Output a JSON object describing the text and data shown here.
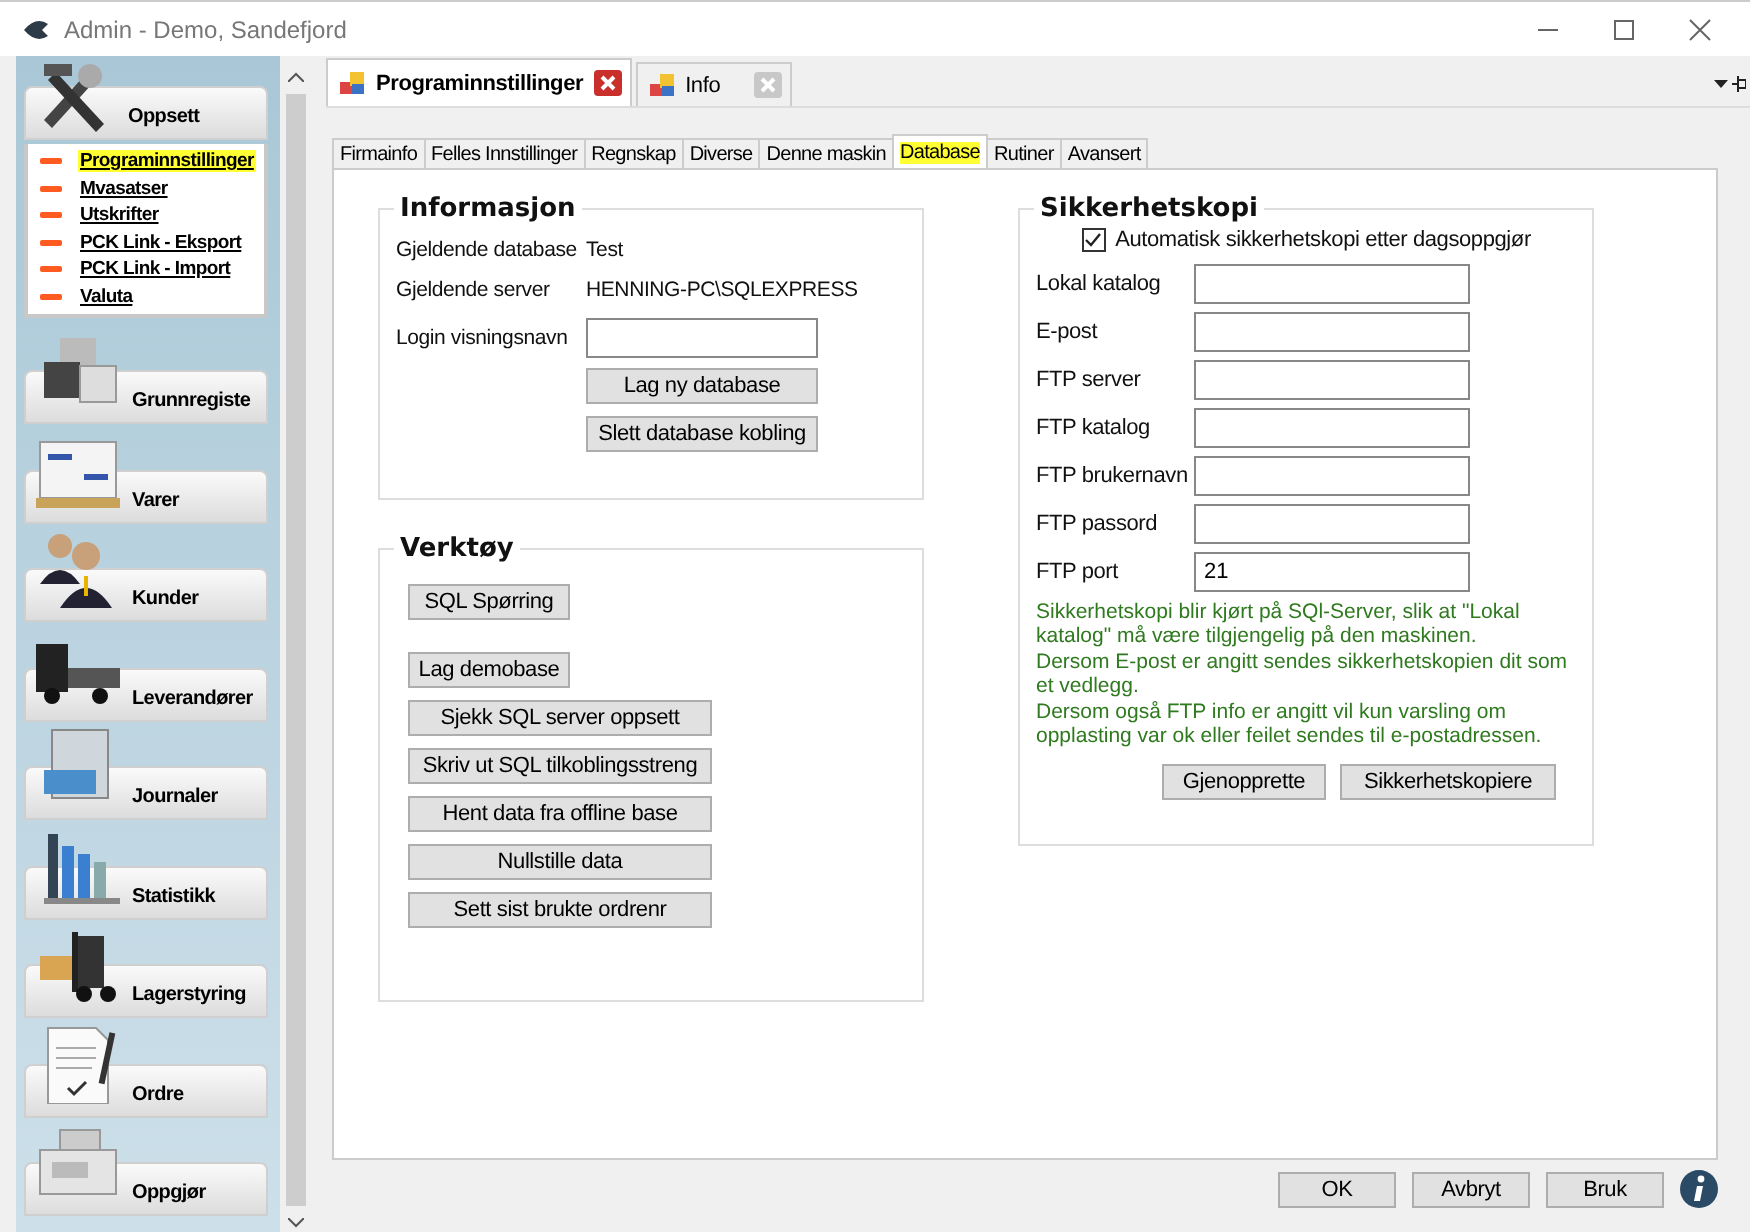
{
  "window": {
    "title": "Admin - Demo, Sandefjord"
  },
  "sidebar": {
    "sections": [
      {
        "label": "Oppsett",
        "expanded": true,
        "items": [
          {
            "label": "Programinnstillinger",
            "selected": true
          },
          {
            "label": "Mvasatser",
            "selected": false
          },
          {
            "label": "Utskrifter",
            "selected": false
          },
          {
            "label": "PCK Link - Eksport",
            "selected": false
          },
          {
            "label": "PCK Link - Import",
            "selected": false
          },
          {
            "label": "Valuta",
            "selected": false
          }
        ]
      },
      {
        "label": "Grunnregiste"
      },
      {
        "label": "Varer"
      },
      {
        "label": "Kunder"
      },
      {
        "label": "Leverandører"
      },
      {
        "label": "Journaler"
      },
      {
        "label": "Statistikk"
      },
      {
        "label": "Lagerstyring"
      },
      {
        "label": "Ordre"
      },
      {
        "label": "Oppgjør"
      }
    ]
  },
  "doc_tabs": [
    {
      "label": "Programinnstillinger",
      "selected": true
    },
    {
      "label": "Info",
      "selected": false
    }
  ],
  "tabs": [
    {
      "label": "Firmainfo",
      "selected": false
    },
    {
      "label": "Felles Innstillinger",
      "selected": false
    },
    {
      "label": "Regnskap",
      "selected": false
    },
    {
      "label": "Diverse",
      "selected": false
    },
    {
      "label": "Denne maskin",
      "selected": false
    },
    {
      "label": "Database",
      "selected": true
    },
    {
      "label": "Rutiner",
      "selected": false
    },
    {
      "label": "Avansert",
      "selected": false
    }
  ],
  "informasjon": {
    "title": "Informasjon",
    "rows": [
      {
        "label": "Gjeldende database",
        "value": "Test"
      },
      {
        "label": "Gjeldende server",
        "value": "HENNING-PC\\SQLEXPRESS"
      }
    ],
    "login": {
      "label": "Login visningsnavn"
    },
    "buttons": [
      "Lag ny database",
      "Slett database kobling"
    ]
  },
  "verktoy": {
    "title": "Verktøy",
    "buttons": [
      {
        "label": "SQL Spørring",
        "kind": "small"
      },
      {
        "label": "Lag demobase",
        "kind": "small"
      },
      {
        "label": "Sjekk SQL server oppsett",
        "kind": "wide"
      },
      {
        "label": "Skriv ut SQL tilkoblingsstreng",
        "kind": "wide"
      },
      {
        "label": "Hent data fra offline base",
        "kind": "wide"
      },
      {
        "label": "Nullstille data",
        "kind": "wide"
      },
      {
        "label": "Sett sist brukte ordrenr",
        "kind": "wide"
      }
    ]
  },
  "sikkerhetskopi": {
    "title": "Sikkerhetskopi",
    "auto": {
      "label": "Automatisk sikkerhetskopi etter dagsoppgjør",
      "checked": true
    },
    "fields": [
      {
        "label": "Lokal katalog"
      },
      {
        "label": "E-post"
      },
      {
        "label": "FTP server"
      },
      {
        "label": "FTP katalog"
      },
      {
        "label": "FTP brukernavn"
      },
      {
        "label": "FTP passord"
      },
      {
        "label": "FTP port",
        "value": "21"
      }
    ],
    "note": [
      "Sikkerhetskopi blir kjørt på SQl-Server, slik at \"Lokal katalog\" må være tilgjengelig på den maskinen.",
      "Dersom E-post er angitt sendes sikkerhetskopien dit som et vedlegg.",
      "Dersom også FTP info er angitt vil kun varsling om opplasting var ok eller feilet sendes til e-postadressen."
    ],
    "buttons": [
      "Gjenopprette",
      "Sikkerhetskopiere"
    ]
  },
  "footer": {
    "buttons": [
      "OK",
      "Avbryt",
      "Bruk"
    ]
  }
}
